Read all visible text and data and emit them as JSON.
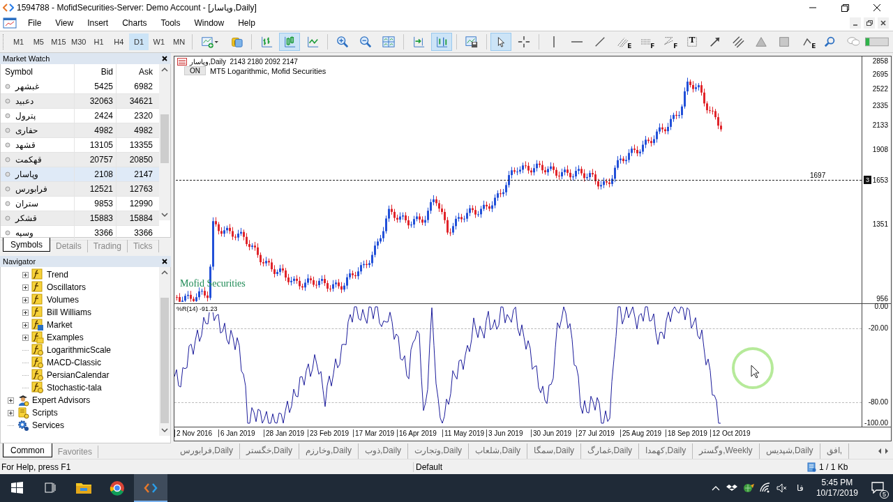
{
  "window": {
    "title": "1594788 - MofidSecurities-Server: Demo Account - [وپاسار,Daily]"
  },
  "menu": [
    "File",
    "View",
    "Insert",
    "Charts",
    "Tools",
    "Window",
    "Help"
  ],
  "timeframes": [
    {
      "label": "M1",
      "selected": false
    },
    {
      "label": "M5",
      "selected": false
    },
    {
      "label": "M15",
      "selected": false
    },
    {
      "label": "M30",
      "selected": false
    },
    {
      "label": "H1",
      "selected": false
    },
    {
      "label": "H4",
      "selected": false
    },
    {
      "label": "D1",
      "selected": true
    },
    {
      "label": "W1",
      "selected": false
    },
    {
      "label": "MN",
      "selected": false
    }
  ],
  "toolbar": [
    {
      "kind": "new-chart",
      "selected": false
    },
    {
      "kind": "coins",
      "selected": false
    },
    {
      "kind": "sep"
    },
    {
      "kind": "bars",
      "selected": false
    },
    {
      "kind": "candles",
      "selected": true
    },
    {
      "kind": "line",
      "selected": false
    },
    {
      "kind": "sep"
    },
    {
      "kind": "zoom-in",
      "selected": false
    },
    {
      "kind": "zoom-out",
      "selected": false
    },
    {
      "kind": "tile",
      "selected": false
    },
    {
      "kind": "sep"
    },
    {
      "kind": "autoscroll",
      "selected": false
    },
    {
      "kind": "shift",
      "selected": true
    },
    {
      "kind": "sep"
    },
    {
      "kind": "template",
      "selected": false
    },
    {
      "kind": "sep"
    },
    {
      "kind": "cursor",
      "selected": true
    },
    {
      "kind": "crosshair",
      "selected": false
    },
    {
      "kind": "sep"
    },
    {
      "kind": "vline",
      "selected": false
    },
    {
      "kind": "hline",
      "selected": false
    },
    {
      "kind": "trend",
      "selected": false
    },
    {
      "kind": "stairs",
      "selected": false,
      "badge": "E"
    },
    {
      "kind": "dots",
      "selected": false,
      "badge": "F"
    },
    {
      "kind": "fan",
      "selected": false,
      "badge": "F"
    },
    {
      "kind": "text",
      "selected": false,
      "badge": "T"
    },
    {
      "kind": "arrow",
      "selected": false
    },
    {
      "kind": "channel",
      "selected": false
    },
    {
      "kind": "triangle",
      "selected": false
    },
    {
      "kind": "rect",
      "selected": false
    },
    {
      "kind": "wave",
      "selected": false,
      "badge": "E"
    },
    {
      "kind": "search",
      "selected": false
    },
    {
      "kind": "chat",
      "selected": false
    }
  ],
  "market_watch": {
    "title": "Market Watch",
    "columns": [
      "Symbol",
      "Bid",
      "Ask"
    ],
    "rows": [
      {
        "symbol": "غبشهر",
        "bid": "5425",
        "ask": "6982",
        "selected": false
      },
      {
        "symbol": "دعبید",
        "bid": "32063",
        "ask": "34621",
        "selected": false
      },
      {
        "symbol": "پترول",
        "bid": "2424",
        "ask": "2320",
        "selected": false
      },
      {
        "symbol": "حفاری",
        "bid": "4982",
        "ask": "4982",
        "selected": false
      },
      {
        "symbol": "قشهد",
        "bid": "13105",
        "ask": "13355",
        "selected": false
      },
      {
        "symbol": "قهکمت",
        "bid": "20757",
        "ask": "20850",
        "selected": false
      },
      {
        "symbol": "وپاسار",
        "bid": "2108",
        "ask": "2147",
        "selected": true
      },
      {
        "symbol": "فرابورس",
        "bid": "12521",
        "ask": "12763",
        "selected": false
      },
      {
        "symbol": "ستران",
        "bid": "9853",
        "ask": "12990",
        "selected": false
      },
      {
        "symbol": "قشکر",
        "bid": "15883",
        "ask": "15884",
        "selected": false
      },
      {
        "symbol": "وسپه",
        "bid": "3366",
        "ask": "3366",
        "selected": false
      }
    ],
    "tabs": [
      {
        "label": "Symbols",
        "selected": true
      },
      {
        "label": "Details",
        "selected": false
      },
      {
        "label": "Trading",
        "selected": false
      },
      {
        "label": "Ticks",
        "selected": false
      }
    ]
  },
  "navigator": {
    "title": "Navigator",
    "tree": [
      {
        "children": [
          {
            "label": "Trend",
            "kind": "folder",
            "expanded": false
          },
          {
            "label": "Oscillators",
            "kind": "folder",
            "expanded": false
          },
          {
            "label": "Volumes",
            "kind": "folder",
            "expanded": false
          },
          {
            "label": "Bill Williams",
            "kind": "folder",
            "expanded": false
          },
          {
            "label": "Market",
            "kind": "market",
            "expanded": false
          },
          {
            "label": "Examples",
            "kind": "examples",
            "expanded": false
          },
          {
            "label": "LogarithmicScale",
            "kind": "indicator"
          },
          {
            "label": "MACD-Classic",
            "kind": "indicator"
          },
          {
            "label": "PersianCalendar",
            "kind": "indicator"
          },
          {
            "label": "Stochastic-tala",
            "kind": "indicator"
          }
        ]
      },
      {
        "label": "Expert Advisors",
        "kind": "experts",
        "expanded": false
      },
      {
        "label": "Scripts",
        "kind": "scripts",
        "expanded": false
      },
      {
        "label": "Services",
        "kind": "services"
      }
    ],
    "tabs": [
      {
        "label": "Common",
        "selected": true
      },
      {
        "label": "Favorites",
        "selected": false
      }
    ]
  },
  "chart": {
    "symbol_line": "وپاسار,Daily  2143 2180 2092 2147",
    "on_button": "ON",
    "indicator_name": "MT5 Logarithmic, Mofid Securities",
    "broker_label": "Mofid Securities",
    "price_labels": [
      "2858",
      "2695",
      "2522",
      "2335",
      "2133",
      "1908",
      "1653",
      "1351",
      "956"
    ],
    "level_line": {
      "label": "1697",
      "badge": "3"
    },
    "oscillator": {
      "label": "%R(14) -91.23",
      "levels": [
        "0.00",
        "-20.00",
        "-80.00",
        "-100.00"
      ]
    },
    "dates": [
      "2 Nov 2016",
      "6 Jan 2019",
      "28 Jan 2019",
      "23 Feb 2019",
      "17 Mar 2019",
      "16 Apr 2019",
      "11 May 2019",
      "3 Jun 2019",
      "30 Jun 2019",
      "27 Jul 2019",
      "25 Aug 2019",
      "18 Sep 2019",
      "12 Oct 2019"
    ]
  },
  "chart_tabs": [
    {
      "label": "فرابورس,Daily",
      "selected": false
    },
    {
      "label": "خگستر,Daily",
      "selected": false
    },
    {
      "label": "وخارزم,Daily",
      "selected": false
    },
    {
      "label": "ذوب,Daily",
      "selected": false
    },
    {
      "label": "وتجارت,Daily",
      "selected": false
    },
    {
      "label": "شلعاب,Daily",
      "selected": false
    },
    {
      "label": "سمگا,Daily",
      "selected": false
    },
    {
      "label": "غمارگ,Daily",
      "selected": false
    },
    {
      "label": "کهمدا,Daily",
      "selected": false
    },
    {
      "label": "وگستر,Weekly",
      "selected": false
    },
    {
      "label": "شپدیس,Daily",
      "selected": false
    },
    {
      "label": "افق,",
      "selected": false
    }
  ],
  "status_bar": {
    "help": "For Help, press F1",
    "profile": "Default",
    "traffic": "1 / 1 Kb"
  },
  "taskbar": {
    "language": "فا",
    "time": "5:45 PM",
    "date": "10/17/2019",
    "notifications": "5"
  }
}
